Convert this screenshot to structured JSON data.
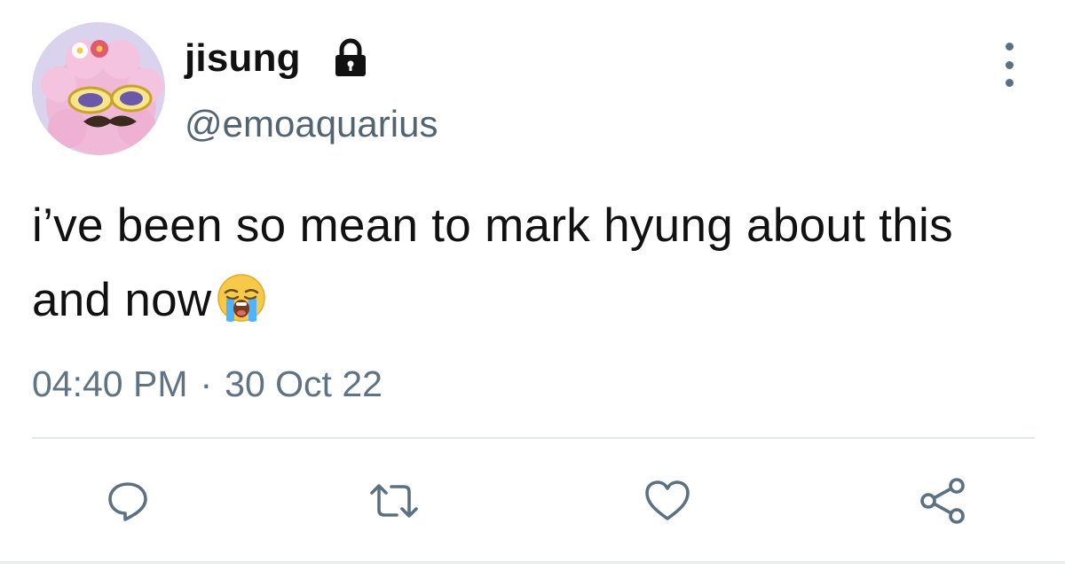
{
  "tweet": {
    "author": {
      "display_name": "jisung",
      "handle": "@emoaquarius",
      "protected_icon": "lock-icon",
      "avatar": "avatar"
    },
    "text": "i’ve been so mean to mark hyung about this and now",
    "text_emoji": "loudly-crying-face-emoji",
    "time": "04:40 PM",
    "separator": "·",
    "date": "30 Oct 22",
    "more_icon": "more-vertical-icon"
  },
  "actions": [
    {
      "name": "reply",
      "icon": "reply-icon"
    },
    {
      "name": "retweet",
      "icon": "retweet-icon"
    },
    {
      "name": "like",
      "icon": "heart-icon"
    },
    {
      "name": "share",
      "icon": "share-icon"
    }
  ],
  "colors": {
    "text": "#111111",
    "secondary": "#536471",
    "icon": "#5b7083",
    "divider": "#e1e8ed"
  }
}
